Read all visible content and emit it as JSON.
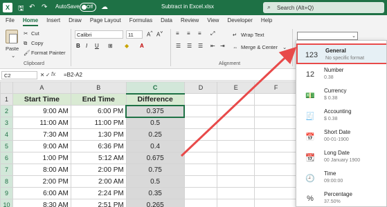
{
  "titlebar": {
    "autosave_label": "AutoSave",
    "autosave_state": "Off",
    "doc_title": "Subtract in Excel.xlsx",
    "search_placeholder": "Search (Alt+Q)"
  },
  "tabs": [
    "File",
    "Home",
    "Insert",
    "Draw",
    "Page Layout",
    "Formulas",
    "Data",
    "Review",
    "View",
    "Developer",
    "Help"
  ],
  "active_tab": "Home",
  "ribbon": {
    "paste": "Paste",
    "cut": "Cut",
    "copy": "Copy",
    "format_painter": "Format Painter",
    "clipboard": "Clipboard",
    "font_name": "Calibri",
    "font_size": "11",
    "wrap_text": "Wrap Text",
    "merge_center": "Merge & Center",
    "alignment": "Alignment"
  },
  "formula_bar": {
    "name_box": "C2",
    "fx": "fx",
    "formula": "=B2-A2"
  },
  "columns": [
    "A",
    "B",
    "C",
    "D",
    "E",
    "F"
  ],
  "selected_column": "C",
  "headers": [
    "Start Time",
    "End Time",
    "Difference"
  ],
  "rows": [
    {
      "n": "1"
    },
    {
      "n": "2",
      "a": "9:00 AM",
      "b": "6:00 PM",
      "c": "0.375"
    },
    {
      "n": "3",
      "a": "11:00 AM",
      "b": "11:00 PM",
      "c": "0.5"
    },
    {
      "n": "4",
      "a": "7:30 AM",
      "b": "1:30 PM",
      "c": "0.25"
    },
    {
      "n": "5",
      "a": "9:00 AM",
      "b": "6:36 PM",
      "c": "0.4"
    },
    {
      "n": "6",
      "a": "1:00 PM",
      "b": "5:12 AM",
      "c": "0.675"
    },
    {
      "n": "7",
      "a": "8:00 AM",
      "b": "2:00 PM",
      "c": "0.75"
    },
    {
      "n": "8",
      "a": "2:00 PM",
      "b": "2:00 AM",
      "c": "0.5"
    },
    {
      "n": "9",
      "a": "6:00 AM",
      "b": "2:24 PM",
      "c": "0.35"
    },
    {
      "n": "10",
      "a": "8:30 AM",
      "b": "2:51 PM",
      "c": "0.265"
    }
  ],
  "number_formats": [
    {
      "name": "General",
      "sub": "No specific format",
      "icon": "clock-123-icon",
      "glyph": "123"
    },
    {
      "name": "Number",
      "sub": "0.38",
      "icon": "number-icon",
      "glyph": "12"
    },
    {
      "name": "Currency",
      "sub": "$ 0.38",
      "icon": "currency-icon",
      "glyph": "💵"
    },
    {
      "name": "Accounting",
      "sub": "$ 0.38",
      "icon": "accounting-icon",
      "glyph": "🧾"
    },
    {
      "name": "Short Date",
      "sub": "00-01-1900",
      "icon": "calendar-icon",
      "glyph": "📅"
    },
    {
      "name": "Long Date",
      "sub": "00 January 1900",
      "icon": "calendar-large-icon",
      "glyph": "📆"
    },
    {
      "name": "Time",
      "sub": "09:00:00",
      "icon": "clock-icon",
      "glyph": "🕘"
    },
    {
      "name": "Percentage",
      "sub": "37.50%",
      "icon": "percent-icon",
      "glyph": "%"
    }
  ],
  "colors": {
    "excel_green": "#1e7145",
    "header_fill": "#d9ead3",
    "diff_fill": "#d9d9d9",
    "arrow_red": "#e84a4a"
  }
}
